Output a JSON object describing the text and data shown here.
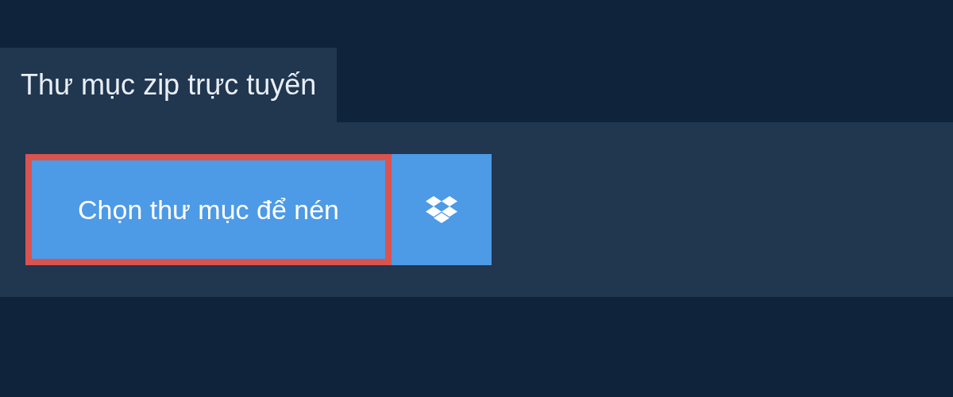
{
  "tab": {
    "label": "Thư mục zip trực tuyến",
    "selected": true
  },
  "choose_button": {
    "label": "Chọn thư mục để nén",
    "focused": true
  }
}
